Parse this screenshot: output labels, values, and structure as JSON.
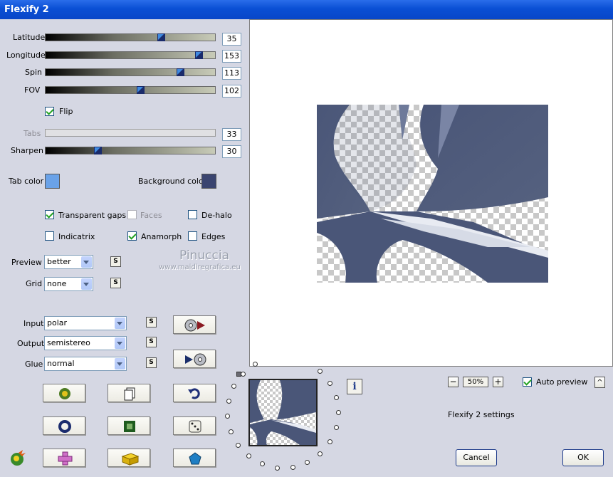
{
  "window": {
    "title": "Flexify 2"
  },
  "sliders": [
    {
      "label": "Latitude",
      "value": "35",
      "frac": 0.68
    },
    {
      "label": "Longitude",
      "value": "153",
      "frac": 0.9
    },
    {
      "label": "Spin",
      "value": "113",
      "frac": 0.79
    },
    {
      "label": "FOV",
      "value": "102",
      "frac": 0.56
    }
  ],
  "flip": {
    "label": "Flip",
    "checked": true
  },
  "tabs": {
    "label": "Tabs",
    "value": "33",
    "disabled": true
  },
  "sharpen": {
    "label": "Sharpen",
    "value": "30",
    "frac": 0.31
  },
  "colors": {
    "tab_label": "Tab color",
    "tab_value": "#6aa2e8",
    "bg_label": "Background color",
    "bg_value": "#3a4470"
  },
  "options": {
    "transparent_gaps": "Transparent gaps",
    "faces": "Faces",
    "dehalo": "De-halo",
    "indicatrix": "Indicatrix",
    "anamorph": "Anamorph",
    "edges": "Edges"
  },
  "preview": {
    "label": "Preview",
    "value": "better"
  },
  "grid": {
    "label": "Grid",
    "value": "none"
  },
  "input": {
    "label": "Input",
    "value": "polar"
  },
  "output": {
    "label": "Output",
    "value": "semistereo"
  },
  "glue": {
    "label": "Glue",
    "value": "normal"
  },
  "s_label": "S",
  "watermark": {
    "name": "Pinuccia",
    "url": "www.maidiregrafica.eu"
  },
  "zoom": {
    "minus": "−",
    "value": "50%",
    "plus": "+"
  },
  "auto_preview": {
    "label": "Auto preview",
    "checked": true,
    "btn": "^"
  },
  "settings_text": "Flexify 2 settings",
  "buttons": {
    "cancel": "Cancel",
    "ok": "OK"
  },
  "info_label": "i",
  "accent": "#0a4fd4",
  "image_color": "#4a5678"
}
